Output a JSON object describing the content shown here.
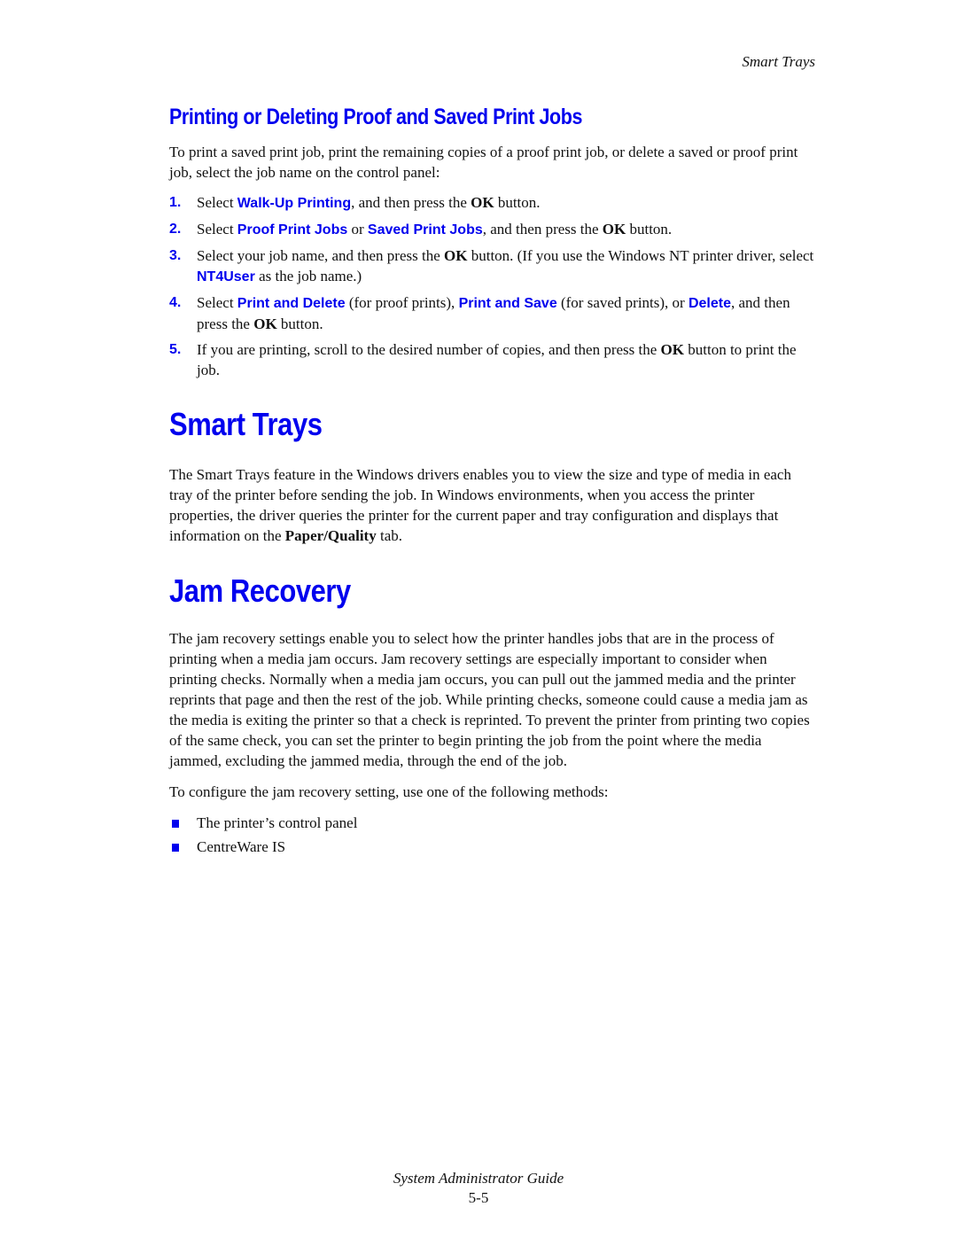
{
  "running_head": "Smart Trays",
  "section1": {
    "heading": "Printing or Deleting Proof and Saved Print Jobs",
    "intro": "To print a saved print job, print the remaining copies of a proof print job, or delete a saved or proof print job, select the job name on the control panel:",
    "steps": [
      {
        "num": "1.",
        "t1": "Select ",
        "u1": "Walk-Up Printing",
        "t2": ", and then press the ",
        "b1": "OK",
        "t3": " button."
      },
      {
        "num": "2.",
        "t1": "Select ",
        "u1": "Proof Print Jobs",
        "t2": " or ",
        "u2": "Saved Print Jobs",
        "t3": ", and then press the ",
        "b1": "OK",
        "t4": " button."
      },
      {
        "num": "3.",
        "t1": "Select your job name, and then press the ",
        "b1": "OK",
        "t2": " button. (If you use the Windows NT printer driver, select ",
        "u1": "NT4User",
        "t3": " as the job name.)"
      },
      {
        "num": "4.",
        "t1": "Select ",
        "u1": "Print and Delete",
        "t2": " (for proof prints), ",
        "u2": "Print and Save",
        "t3": " (for saved prints), or ",
        "u3": "Delete",
        "t4": ", and then press the ",
        "b1": "OK",
        "t5": " button."
      },
      {
        "num": "5.",
        "t1": "If you are printing, scroll to the desired number of copies, and then press the ",
        "b1": "OK",
        "t2": " button to print the job."
      }
    ]
  },
  "section2": {
    "heading": "Smart Trays",
    "p1": "The Smart Trays feature in the Windows drivers enables you to view the size and type of media in each tray of the printer before sending the job. In Windows environments, when you access the printer properties, the driver queries the printer for the current paper and tray configuration and displays that information on the ",
    "p1_bold": "Paper/Quality",
    "p1_end": " tab."
  },
  "section3": {
    "heading": "Jam Recovery",
    "p1": "The jam recovery settings enable you to select how the printer handles jobs that are in the process of printing when a media jam occurs. Jam recovery settings are especially important to consider when printing checks. Normally when a media jam occurs, you can pull out the jammed media and the printer reprints that page and then the rest of the job. While printing checks, someone could cause a media jam as the media is exiting the printer so that a check is reprinted. To prevent the printer from printing two copies of the same check, you can set the printer to begin printing the job from the point where the media jammed, excluding the jammed media, through the end of the job.",
    "p2": "To configure the jam recovery setting, use one of the following methods:",
    "bullets": [
      "The printer’s control panel",
      "CentreWare IS"
    ]
  },
  "footer": {
    "title": "System Administrator Guide",
    "page": "5-5"
  },
  "colors": {
    "accent": "#0000ee",
    "text": "#111111"
  }
}
